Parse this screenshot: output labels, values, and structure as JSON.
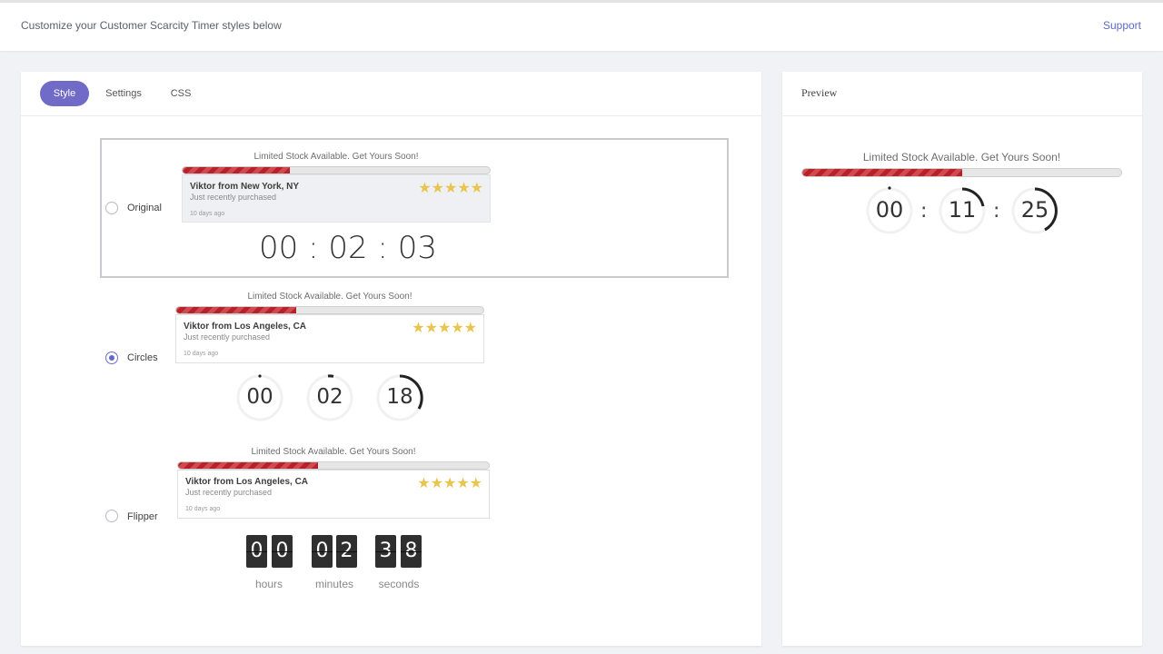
{
  "header": {
    "text": "Customize your Customer Scarcity Timer styles below",
    "support_label": "Support"
  },
  "tabs": [
    {
      "label": "Style",
      "active": true
    },
    {
      "label": "Settings",
      "active": false
    },
    {
      "label": "CSS",
      "active": false
    }
  ],
  "options": [
    {
      "label": "Original",
      "selected": false,
      "widget": {
        "title": "Limited Stock Available. Get Yours Soon!",
        "progress_fraction": 0.35,
        "card": {
          "name": "Viktor from New York, NY",
          "sub": "Just recently purchased",
          "ago": "10 days ago",
          "stars": "★★★★★"
        },
        "timer": {
          "hours": "00",
          "minutes": "02",
          "seconds": "03"
        }
      }
    },
    {
      "label": "Circles",
      "selected": true,
      "widget": {
        "title": "Limited Stock Available. Get Yours Soon!",
        "progress_fraction": 0.39,
        "card": {
          "name": "Viktor from Los Angeles, CA",
          "sub": "Just recently purchased",
          "ago": "10 days ago",
          "stars": "★★★★★"
        },
        "timer": {
          "hours": "00",
          "minutes": "02",
          "seconds": "18"
        }
      }
    },
    {
      "label": "Flipper",
      "selected": false,
      "widget": {
        "title": "Limited Stock Available. Get Yours Soon!",
        "progress_fraction": 0.45,
        "card": {
          "name": "Viktor from Los Angeles, CA",
          "sub": "Just recently purchased",
          "ago": "10 days ago",
          "stars": "★★★★★"
        },
        "timer": {
          "hours": [
            "0",
            "0"
          ],
          "minutes": [
            "0",
            "2"
          ],
          "seconds": [
            "3",
            "8"
          ]
        },
        "units": {
          "hours": "hours",
          "minutes": "minutes",
          "seconds": "seconds"
        }
      }
    }
  ],
  "preview": {
    "title": "Preview",
    "widget_title": "Limited Stock Available. Get Yours Soon!",
    "progress_fraction": 0.5,
    "timer": {
      "hours": "00",
      "minutes": "11",
      "seconds": "25"
    },
    "colon": ":"
  },
  "colors": {
    "accent": "#6f6bc6",
    "link": "#5c6ac4",
    "bar_red": "#b8202a",
    "star": "#e9c44e"
  }
}
